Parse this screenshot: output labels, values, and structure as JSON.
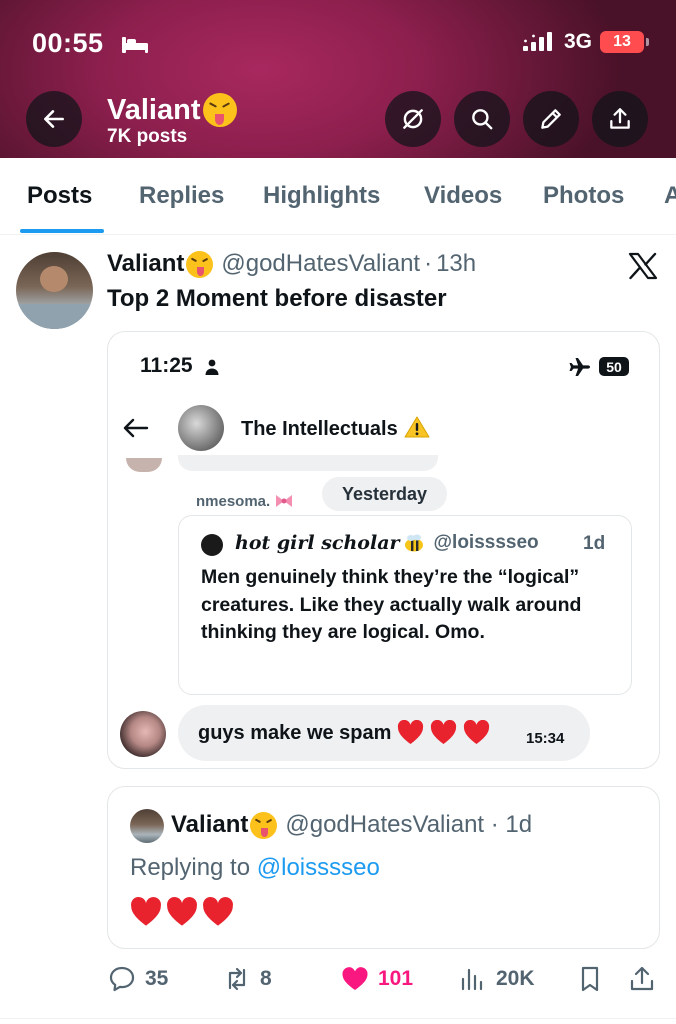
{
  "status_bar": {
    "time": "00:55",
    "network": "3G",
    "battery": "13"
  },
  "header": {
    "name": "Valiant",
    "posts_count": "7K posts"
  },
  "tabs": [
    {
      "label": "Posts",
      "active": true
    },
    {
      "label": "Replies",
      "active": false
    },
    {
      "label": "Highlights",
      "active": false
    },
    {
      "label": "Videos",
      "active": false
    },
    {
      "label": "Photos",
      "active": false
    },
    {
      "label": "A",
      "active": false
    }
  ],
  "post": {
    "author_name": "Valiant",
    "handle": "@godHatesValiant",
    "dot": "·",
    "time": "13h",
    "text": "Top 2 Moment before disaster"
  },
  "screenshot": {
    "time": "11:25",
    "battery": "50",
    "group_name": "The Intellectuals",
    "sender": "nmesoma.",
    "day_chip": "Yesterday",
    "quote": {
      "name": "hot girl scholar",
      "handle": "@loisssseo",
      "time": "1d",
      "text": "Men genuinely think they’re the “logical” creatures. Like they actually walk around thinking they are logical. Omo."
    },
    "message": {
      "text": "guys make we spam",
      "time": "15:34"
    }
  },
  "reply": {
    "name": "Valiant",
    "meta": "@godHatesValiant · 1d",
    "replying_prefix": "Replying to ",
    "replying_to": "@loisssseo"
  },
  "actions": {
    "replies": "35",
    "reposts": "8",
    "likes": "101",
    "views": "20K"
  },
  "colors": {
    "accent": "#1d9bf0",
    "like": "#f91880",
    "header_bg": "#8c1f4d"
  }
}
